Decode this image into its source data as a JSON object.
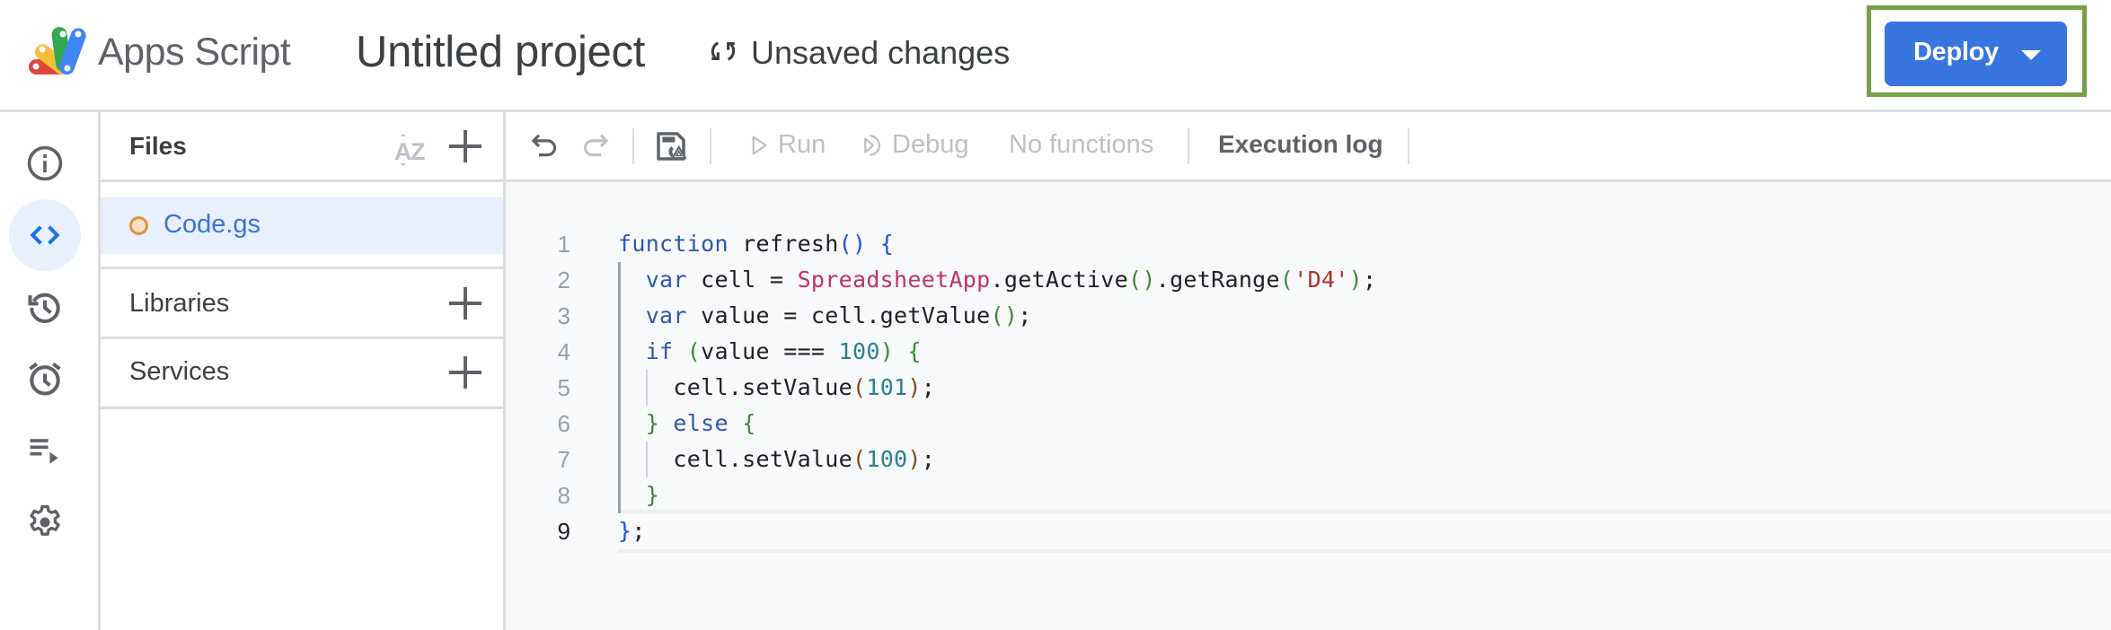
{
  "header": {
    "app_name": "Apps Script",
    "project_title": "Untitled project",
    "save_status": "Unsaved changes",
    "deploy_label": "Deploy",
    "brand_color": "#3975e0",
    "highlight_color": "#76a04a"
  },
  "rail": {
    "items": [
      {
        "name": "overview",
        "icon": "info-icon",
        "active": false
      },
      {
        "name": "editor",
        "icon": "code-icon",
        "active": true
      },
      {
        "name": "project-history",
        "icon": "history-icon",
        "active": false
      },
      {
        "name": "triggers",
        "icon": "alarm-clock-icon",
        "active": false
      },
      {
        "name": "executions",
        "icon": "executions-list-icon",
        "active": false
      },
      {
        "name": "project-settings",
        "icon": "gear-icon",
        "active": false
      }
    ]
  },
  "files_panel": {
    "files_title": "Files",
    "files": [
      {
        "name": "Code.gs",
        "status": "unsaved",
        "selected": true
      }
    ],
    "libraries_title": "Libraries",
    "services_title": "Services"
  },
  "toolbar": {
    "run_label": "Run",
    "debug_label": "Debug",
    "function_select": "No functions",
    "execution_log_label": "Execution log"
  },
  "editor": {
    "current_line": 9,
    "lines": [
      {
        "n": "1",
        "tokens": [
          [
            "kw",
            "function"
          ],
          [
            "plain",
            " refresh"
          ],
          [
            "b1",
            "()"
          ],
          [
            "plain",
            " "
          ],
          [
            "b1",
            "{"
          ]
        ]
      },
      {
        "n": "2",
        "tokens": [
          [
            "plain",
            "  "
          ],
          [
            "kw",
            "var"
          ],
          [
            "plain",
            " cell = "
          ],
          [
            "cls",
            "SpreadsheetApp"
          ],
          [
            "plain",
            ".getActive"
          ],
          [
            "b2",
            "()"
          ],
          [
            "plain",
            ".getRange"
          ],
          [
            "b2",
            "("
          ],
          [
            "str",
            "'D4'"
          ],
          [
            "b2",
            ")"
          ],
          [
            "plain",
            ";"
          ]
        ]
      },
      {
        "n": "3",
        "tokens": [
          [
            "plain",
            "  "
          ],
          [
            "kw",
            "var"
          ],
          [
            "plain",
            " value = cell.getValue"
          ],
          [
            "b2",
            "()"
          ],
          [
            "plain",
            ";"
          ]
        ]
      },
      {
        "n": "4",
        "tokens": [
          [
            "plain",
            "  "
          ],
          [
            "kw",
            "if"
          ],
          [
            "plain",
            " "
          ],
          [
            "b2",
            "("
          ],
          [
            "plain",
            "value === "
          ],
          [
            "num",
            "100"
          ],
          [
            "b2",
            ")"
          ],
          [
            "plain",
            " "
          ],
          [
            "b2",
            "{"
          ]
        ]
      },
      {
        "n": "5",
        "tokens": [
          [
            "plain",
            "    cell.setValue"
          ],
          [
            "b3",
            "("
          ],
          [
            "num",
            "101"
          ],
          [
            "b3",
            ")"
          ],
          [
            "plain",
            ";"
          ]
        ]
      },
      {
        "n": "6",
        "tokens": [
          [
            "plain",
            "  "
          ],
          [
            "b2",
            "}"
          ],
          [
            "plain",
            " "
          ],
          [
            "kw",
            "else"
          ],
          [
            "plain",
            " "
          ],
          [
            "b2",
            "{"
          ]
        ]
      },
      {
        "n": "7",
        "tokens": [
          [
            "plain",
            "    cell.setValue"
          ],
          [
            "b3",
            "("
          ],
          [
            "num",
            "100"
          ],
          [
            "b3",
            ")"
          ],
          [
            "plain",
            ";"
          ]
        ]
      },
      {
        "n": "8",
        "tokens": [
          [
            "plain",
            "  "
          ],
          [
            "b2",
            "}"
          ]
        ]
      },
      {
        "n": "9",
        "tokens": [
          [
            "b1",
            "}"
          ],
          [
            "plain",
            ";"
          ]
        ]
      }
    ]
  }
}
